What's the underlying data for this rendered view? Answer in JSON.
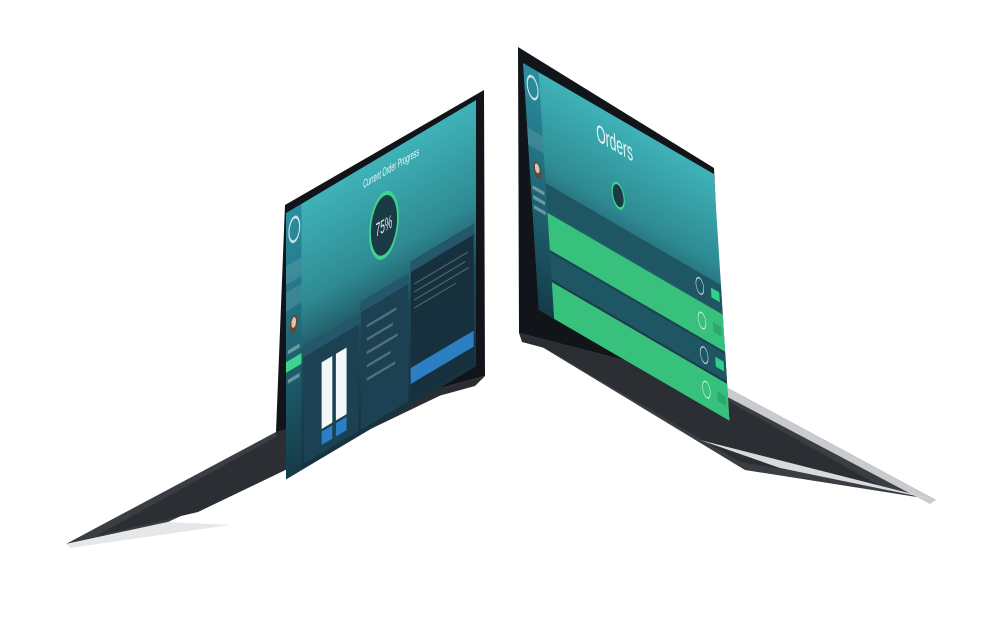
{
  "laptop_left": {
    "header_title": "Current Order Progress",
    "progress_value": "75%"
  },
  "laptop_right": {
    "header_title": "Orders"
  },
  "colors": {
    "teal": "#3fb3b8",
    "navy": "#18323f",
    "green": "#38c07d",
    "blue": "#2b7fc2",
    "bezel": "#111418",
    "body": "#2a2d31",
    "aluminum": "#d8dadd"
  }
}
